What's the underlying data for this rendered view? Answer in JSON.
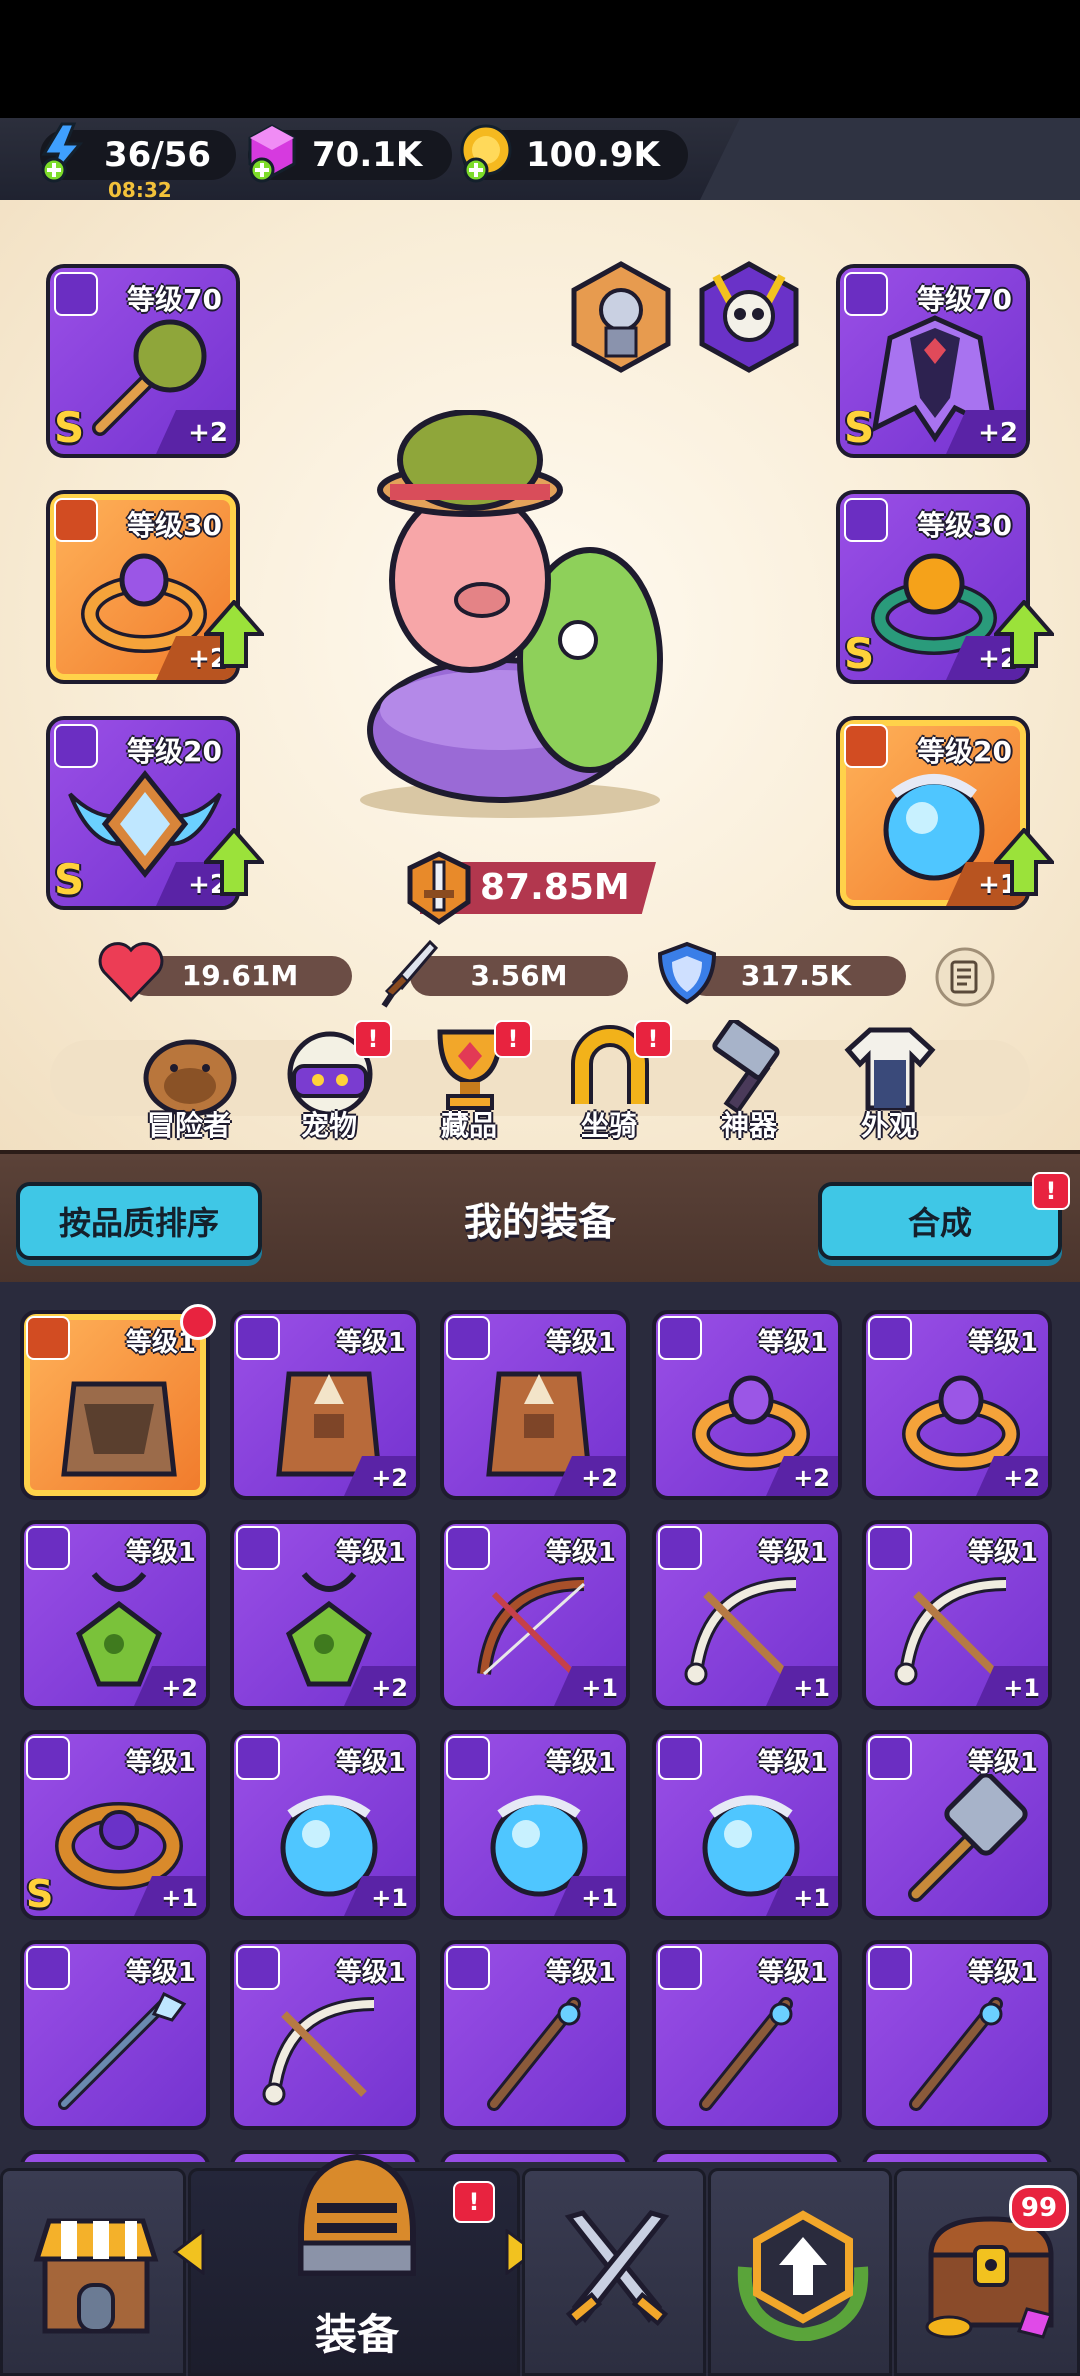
{
  "resources": {
    "energy": "36/56",
    "energy_timer": "08:32",
    "gems": "70.1K",
    "gold": "100.9K"
  },
  "equipped": {
    "weapon": {
      "level": "等级70",
      "rank": "S",
      "plus": "+2"
    },
    "armor": {
      "level": "等级70",
      "rank": "S",
      "plus": "+2"
    },
    "ring_left": {
      "level": "等级30",
      "plus": "+2"
    },
    "ring_right": {
      "level": "等级30",
      "rank": "S",
      "plus": "+2"
    },
    "necklace_left": {
      "level": "等级20",
      "rank": "S",
      "plus": "+2"
    },
    "necklace_right": {
      "level": "等级20",
      "plus": "+1"
    }
  },
  "power": "87.85M",
  "stats": {
    "hp": "19.61M",
    "attack": "3.56M",
    "defense": "317.5K"
  },
  "nav": [
    {
      "label": "冒险者",
      "badge": ""
    },
    {
      "label": "宠物",
      "badge": "!"
    },
    {
      "label": "藏品",
      "badge": "!"
    },
    {
      "label": "坐骑",
      "badge": "!"
    },
    {
      "label": "神器",
      "badge": ""
    },
    {
      "label": "外观",
      "badge": ""
    }
  ],
  "equipment_header": {
    "sort_button": "按品质排序",
    "title": "我的装备",
    "merge_button": "合成",
    "merge_badge": "!"
  },
  "inventory": [
    {
      "level": "等级1",
      "plus": "",
      "rank": "",
      "item": "armor-fur",
      "quality": "orange"
    },
    {
      "level": "等级1",
      "plus": "+2",
      "rank": "",
      "item": "armor-vest",
      "quality": "purple"
    },
    {
      "level": "等级1",
      "plus": "+2",
      "rank": "",
      "item": "armor-vest",
      "quality": "purple"
    },
    {
      "level": "等级1",
      "plus": "+2",
      "rank": "",
      "item": "ring-gold",
      "quality": "purple"
    },
    {
      "level": "等级1",
      "plus": "+2",
      "rank": "",
      "item": "ring-gold",
      "quality": "purple"
    },
    {
      "level": "等级1",
      "plus": "+2",
      "rank": "",
      "item": "necklace-green",
      "quality": "purple"
    },
    {
      "level": "等级1",
      "plus": "+2",
      "rank": "",
      "item": "necklace-green",
      "quality": "purple"
    },
    {
      "level": "等级1",
      "plus": "+1",
      "rank": "",
      "item": "bow-red",
      "quality": "purple"
    },
    {
      "level": "等级1",
      "plus": "+1",
      "rank": "",
      "item": "bow-bone",
      "quality": "purple"
    },
    {
      "level": "等级1",
      "plus": "+1",
      "rank": "",
      "item": "bow-bone",
      "quality": "purple"
    },
    {
      "level": "等级1",
      "plus": "+1",
      "rank": "S",
      "item": "ring-ornate",
      "quality": "purple"
    },
    {
      "level": "等级1",
      "plus": "+1",
      "rank": "",
      "item": "necklace-blue",
      "quality": "purple"
    },
    {
      "level": "等级1",
      "plus": "+1",
      "rank": "",
      "item": "necklace-blue",
      "quality": "purple"
    },
    {
      "level": "等级1",
      "plus": "+1",
      "rank": "",
      "item": "necklace-blue",
      "quality": "purple"
    },
    {
      "level": "等级1",
      "plus": "",
      "rank": "",
      "item": "hammer-stone",
      "quality": "purple"
    },
    {
      "level": "等级1",
      "plus": "",
      "rank": "",
      "item": "spear-ice",
      "quality": "purple"
    },
    {
      "level": "等级1",
      "plus": "",
      "rank": "",
      "item": "bow-bone",
      "quality": "purple"
    },
    {
      "level": "等级1",
      "plus": "",
      "rank": "",
      "item": "staff-wood",
      "quality": "purple"
    },
    {
      "level": "等级1",
      "plus": "",
      "rank": "",
      "item": "staff-wood",
      "quality": "purple"
    },
    {
      "level": "等级1",
      "plus": "",
      "rank": "",
      "item": "staff-wood",
      "quality": "purple"
    }
  ],
  "bottom_nav": {
    "active_label": "装备",
    "active_badge": "!",
    "chest_badge": "99"
  },
  "colors": {
    "purple_quality": "#8a43dc",
    "orange_quality": "#f59444",
    "cyan_button": "#3fc7e6",
    "badge_red": "#e8233f",
    "upgrade_green": "#9be23a"
  }
}
